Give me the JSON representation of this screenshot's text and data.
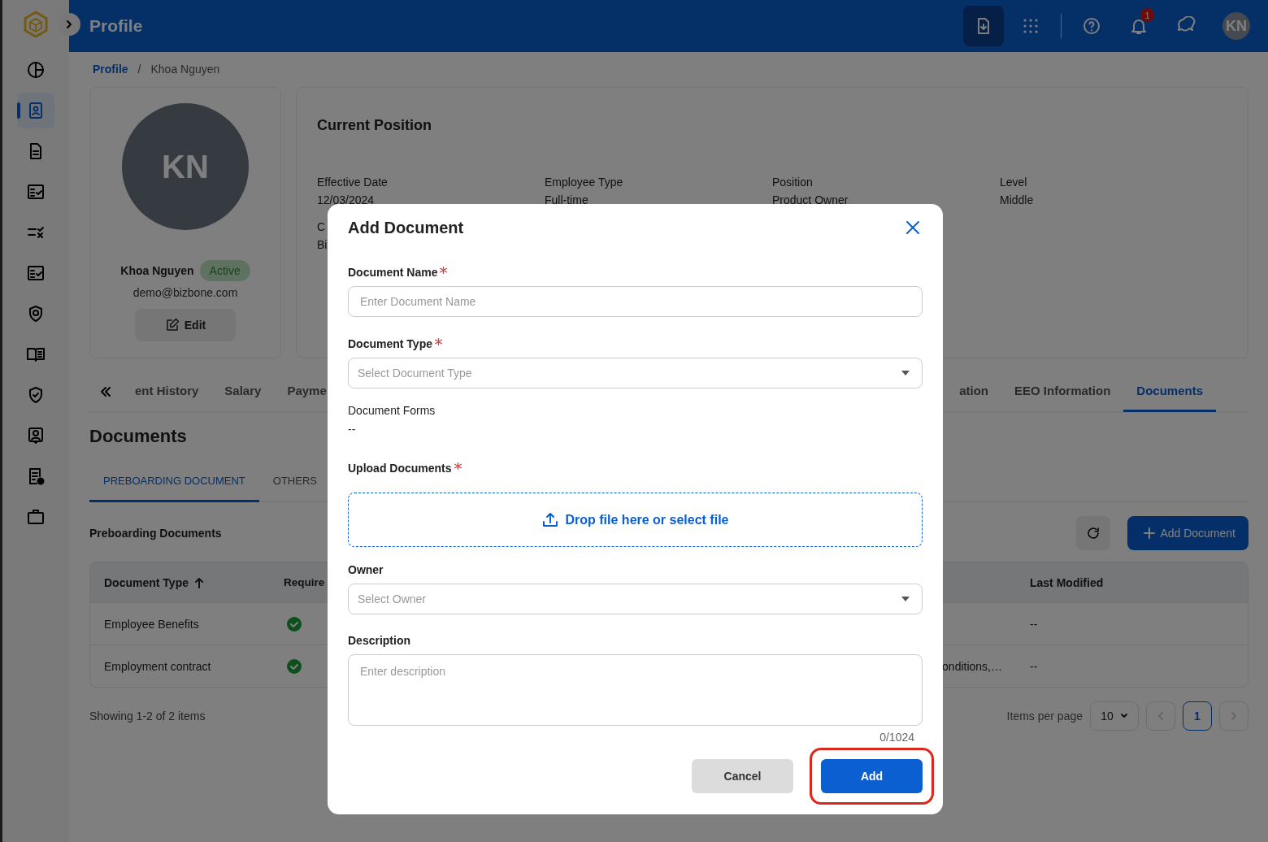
{
  "app": {
    "title": "Profile"
  },
  "header_actions": {
    "notifications": "1",
    "avatar": "KN"
  },
  "sidebar": {
    "items": [
      {
        "selected": false
      },
      {
        "selected": true
      },
      {
        "selected": false
      },
      {
        "selected": false
      },
      {
        "selected": false
      },
      {
        "selected": false
      },
      {
        "selected": false
      },
      {
        "selected": false
      },
      {
        "selected": false
      },
      {
        "selected": false
      },
      {
        "selected": false
      },
      {
        "selected": false
      }
    ]
  },
  "breadcrumb": {
    "separator": "/",
    "items": [
      {
        "label": "Profile",
        "kind": "link"
      },
      {
        "label": "Khoa Nguyen",
        "kind": "current"
      }
    ]
  },
  "profile": {
    "initials": "KN",
    "name": "Khoa Nguyen",
    "status": "Active",
    "email": "demo@bizbone.com",
    "edit_label": "Edit"
  },
  "current_position": {
    "title": "Current Position",
    "fields": [
      {
        "label": "Effective Date",
        "value": "12/03/2024"
      },
      {
        "label": "Employee Type",
        "value": "Full-time"
      },
      {
        "label": "Position",
        "value": "Product Owner"
      },
      {
        "label": "Level",
        "value": "Middle"
      },
      {
        "label": "C",
        "value": "Bi"
      }
    ]
  },
  "profile_tabs": {
    "left": [
      {
        "label": "ent History",
        "selected": false
      },
      {
        "label": "Salary",
        "selected": false
      },
      {
        "label": "Payme",
        "selected": false
      }
    ],
    "right": [
      {
        "label": "ation",
        "selected": false
      },
      {
        "label": "EEO Information",
        "selected": false
      },
      {
        "label": "Documents",
        "selected": true
      }
    ]
  },
  "documents": {
    "title": "Documents",
    "tabs": [
      {
        "label": "PREBOARDING DOCUMENT",
        "selected": true
      },
      {
        "label": "OTHERS",
        "selected": false
      }
    ],
    "section_title": "Preboarding Documents",
    "add_label": "Add Document",
    "table": {
      "columns": [
        {
          "label": "Document Type",
          "sorted": true
        },
        {
          "label": "Require"
        },
        {
          "label": "Last Modified",
          "sorted": false
        }
      ],
      "rows": [
        {
          "document_type": "Employee Benefits",
          "required": true,
          "last_modified": "--"
        },
        {
          "document_type": "Employment contract",
          "required": true,
          "column_3": "onditions,…",
          "last_modified": "--"
        }
      ]
    },
    "pagination": {
      "summary": "Showing 1-2 of 2 items",
      "per_page_label": "Items per page",
      "per_page": "10",
      "pages": [
        {
          "label": "1",
          "selected": true
        }
      ]
    }
  },
  "dialog": {
    "title": "Add Document",
    "fields": [
      {
        "kind": "text",
        "label": "Document Name",
        "required": true,
        "placeholder": "Enter Document Name"
      },
      {
        "kind": "select",
        "label": "Document Type",
        "required": true,
        "placeholder": "Select Document Type"
      },
      {
        "kind": "info",
        "label": "Document Forms",
        "required": false,
        "value": "--"
      },
      {
        "kind": "upload",
        "label": "Upload Documents",
        "required": true,
        "prompt": "Drop file here or select file"
      },
      {
        "kind": "select",
        "label": "Owner",
        "required": false,
        "placeholder": "Select Owner"
      },
      {
        "kind": "textarea",
        "label": "Description",
        "required": false,
        "placeholder": "Enter description",
        "counter": "0/1024"
      }
    ],
    "buttons": [
      {
        "label": "Cancel",
        "kind": "secondary",
        "highlighted": false
      },
      {
        "label": "Add",
        "kind": "primary",
        "highlighted": true
      }
    ]
  }
}
